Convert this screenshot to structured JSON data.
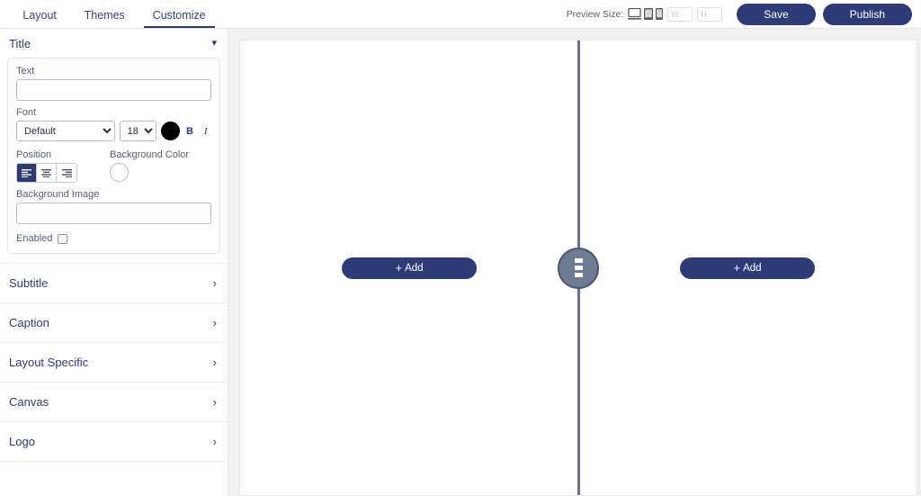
{
  "header": {
    "tabs": [
      {
        "label": "Layout",
        "active": false
      },
      {
        "label": "Themes",
        "active": false
      },
      {
        "label": "Customize",
        "active": true
      }
    ],
    "preview": {
      "label": "Preview Size:",
      "devices": [
        "desktop-icon",
        "tablet-icon",
        "mobile-icon"
      ],
      "width_placeholder": "W",
      "width_value": "",
      "height_placeholder": "H",
      "height_value": ""
    },
    "save_label": "Save",
    "publish_label": "Publish"
  },
  "sidebar": {
    "title_section": {
      "label": "Title",
      "expanded": true,
      "chevron": "chevron-down-icon",
      "text_label": "Text",
      "text_value": "",
      "font_label": "Font",
      "font_value": "Default",
      "font_options": [
        "Default"
      ],
      "size_value": "18",
      "size_options": [
        "18"
      ],
      "color_value": "#000000",
      "bold_label": "B",
      "italic_label": "I",
      "position_label": "Position",
      "position_options": [
        "left",
        "center",
        "right"
      ],
      "position_selected": "left",
      "background_color_label": "Background Color",
      "background_color_value": "#ffffff",
      "background_image_label": "Background Image",
      "background_image_value": "",
      "enabled_label": "Enabled",
      "enabled_checked": false
    },
    "sections": [
      {
        "label": "Subtitle",
        "chevron": "chevron-right-icon"
      },
      {
        "label": "Caption",
        "chevron": "chevron-right-icon"
      },
      {
        "label": "Layout Specific",
        "chevron": "chevron-right-icon"
      },
      {
        "label": "Canvas",
        "chevron": "chevron-right-icon"
      },
      {
        "label": "Logo",
        "chevron": "chevron-right-icon"
      }
    ]
  },
  "canvas": {
    "add_left_label": "Add",
    "add_right_label": "Add",
    "plus_glyph": "+",
    "divider_color": "#6a7490",
    "handle_color": "#6f7a93"
  },
  "colors": {
    "accent": "#2d3c77",
    "text": "#36457c",
    "canvas_bg": "#f1f1f1"
  }
}
